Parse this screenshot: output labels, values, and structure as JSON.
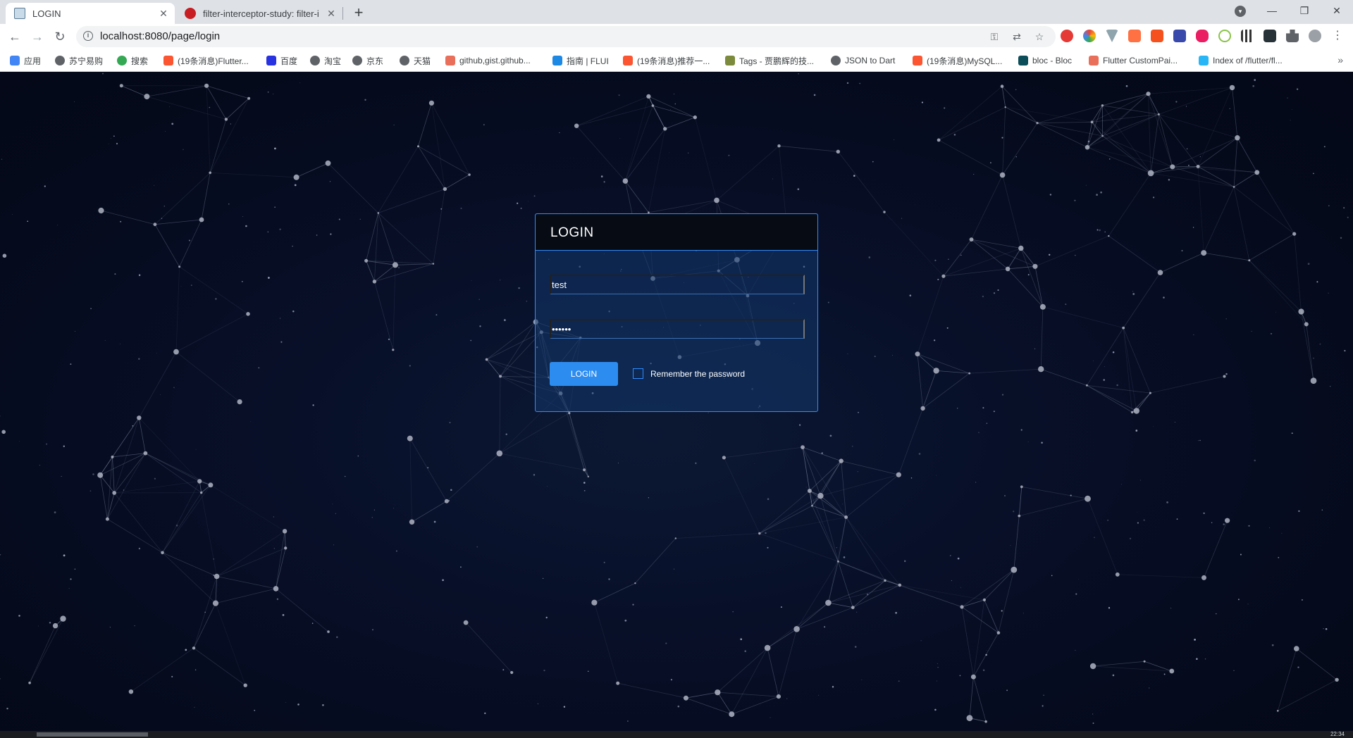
{
  "browser": {
    "tabs": [
      {
        "title": "LOGIN",
        "favicon": "image-favicon-icon",
        "active": true
      },
      {
        "title": "filter-interceptor-study: filter-i",
        "favicon": "gitee-favicon-icon",
        "active": false
      }
    ],
    "new_tab_label": "+",
    "window_controls": {
      "minimize": "—",
      "restore": "❐",
      "close": "✕"
    },
    "address": {
      "url": "localhost:8080/page/login",
      "back": "←",
      "forward": "→",
      "reload": "↻",
      "info_icon": "i"
    },
    "bookmarks": [
      {
        "label": "应用",
        "icon": "apps-grid-icon",
        "color": "#4285f4"
      },
      {
        "label": "苏宁易购",
        "icon": "globe-icon",
        "color": "#5f6368"
      },
      {
        "label": "搜索",
        "icon": "search-icon",
        "color": "#34a853"
      },
      {
        "label": "(19条消息)Flutter...",
        "icon": "csdn-icon",
        "color": "#fc5531"
      },
      {
        "label": "百度",
        "icon": "baidu-icon",
        "color": "#2932e1"
      },
      {
        "label": "淘宝",
        "icon": "globe-icon",
        "color": "#5f6368"
      },
      {
        "label": "京东",
        "icon": "globe-icon",
        "color": "#5f6368"
      },
      {
        "label": "天猫",
        "icon": "globe-icon",
        "color": "#5f6368"
      },
      {
        "label": "github,gist.github...",
        "icon": "jianshu-icon",
        "color": "#ea6f5a"
      },
      {
        "label": "指南 | FLUI",
        "icon": "flui-icon",
        "color": "#1e88e5"
      },
      {
        "label": "(19条消息)推荐一...",
        "icon": "csdn-icon",
        "color": "#fc5531"
      },
      {
        "label": "Tags - 贾鹏辉的技...",
        "icon": "blog-icon",
        "color": "#7b8a3c"
      },
      {
        "label": "JSON to Dart",
        "icon": "globe-icon",
        "color": "#5f6368"
      },
      {
        "label": "(19条消息)MySQL...",
        "icon": "csdn-icon",
        "color": "#fc5531"
      },
      {
        "label": "bloc - Bloc",
        "icon": "bloc-icon",
        "color": "#0b4d58"
      },
      {
        "label": "Flutter CustomPai...",
        "icon": "jianshu-icon",
        "color": "#ea6f5a"
      },
      {
        "label": "Index of /flutter/fl...",
        "icon": "flutter-icon",
        "color": "#29b6f6"
      }
    ],
    "bookmarks_more": "»"
  },
  "login": {
    "title": "LOGIN",
    "username_value": "test",
    "password_value": "••••••",
    "button_label": "LOGIN",
    "remember_label": "Remember the password",
    "remember_checked": false,
    "accent_color": "#2d8cf0"
  },
  "taskbar": {
    "clock": "22:34"
  }
}
